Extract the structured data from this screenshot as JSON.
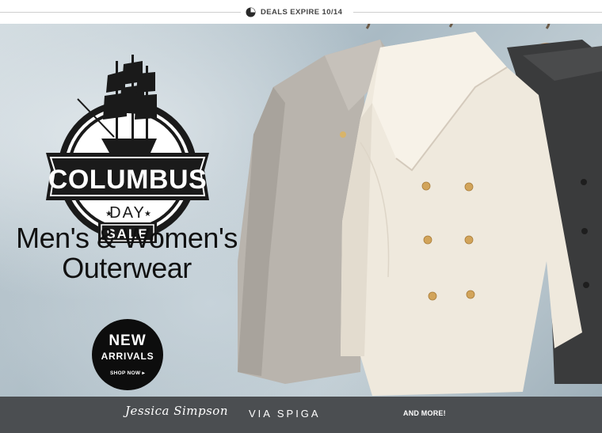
{
  "top_bar": {
    "deals_text": "DEALS EXPIRE 10/14",
    "icon": "clock-icon"
  },
  "badge": {
    "title": "COLUMBUS",
    "subtitle": "DAY",
    "tag": "SALE",
    "icon": "ship-icon"
  },
  "headline": {
    "line1": "Men's & Women's",
    "line2": "Outerwear"
  },
  "cta": {
    "line1": "NEW",
    "line2": "ARRIVALS",
    "line3": "SHOP NOW ▸"
  },
  "brands": {
    "brand1": "Jessica Simpson",
    "brand2": "VIA SPIGA",
    "more": "AND MORE!"
  },
  "colors": {
    "brand_bar": "#4b4e51",
    "badge_dark": "#1a1a1a",
    "cta_bg": "#0d0d0d"
  }
}
